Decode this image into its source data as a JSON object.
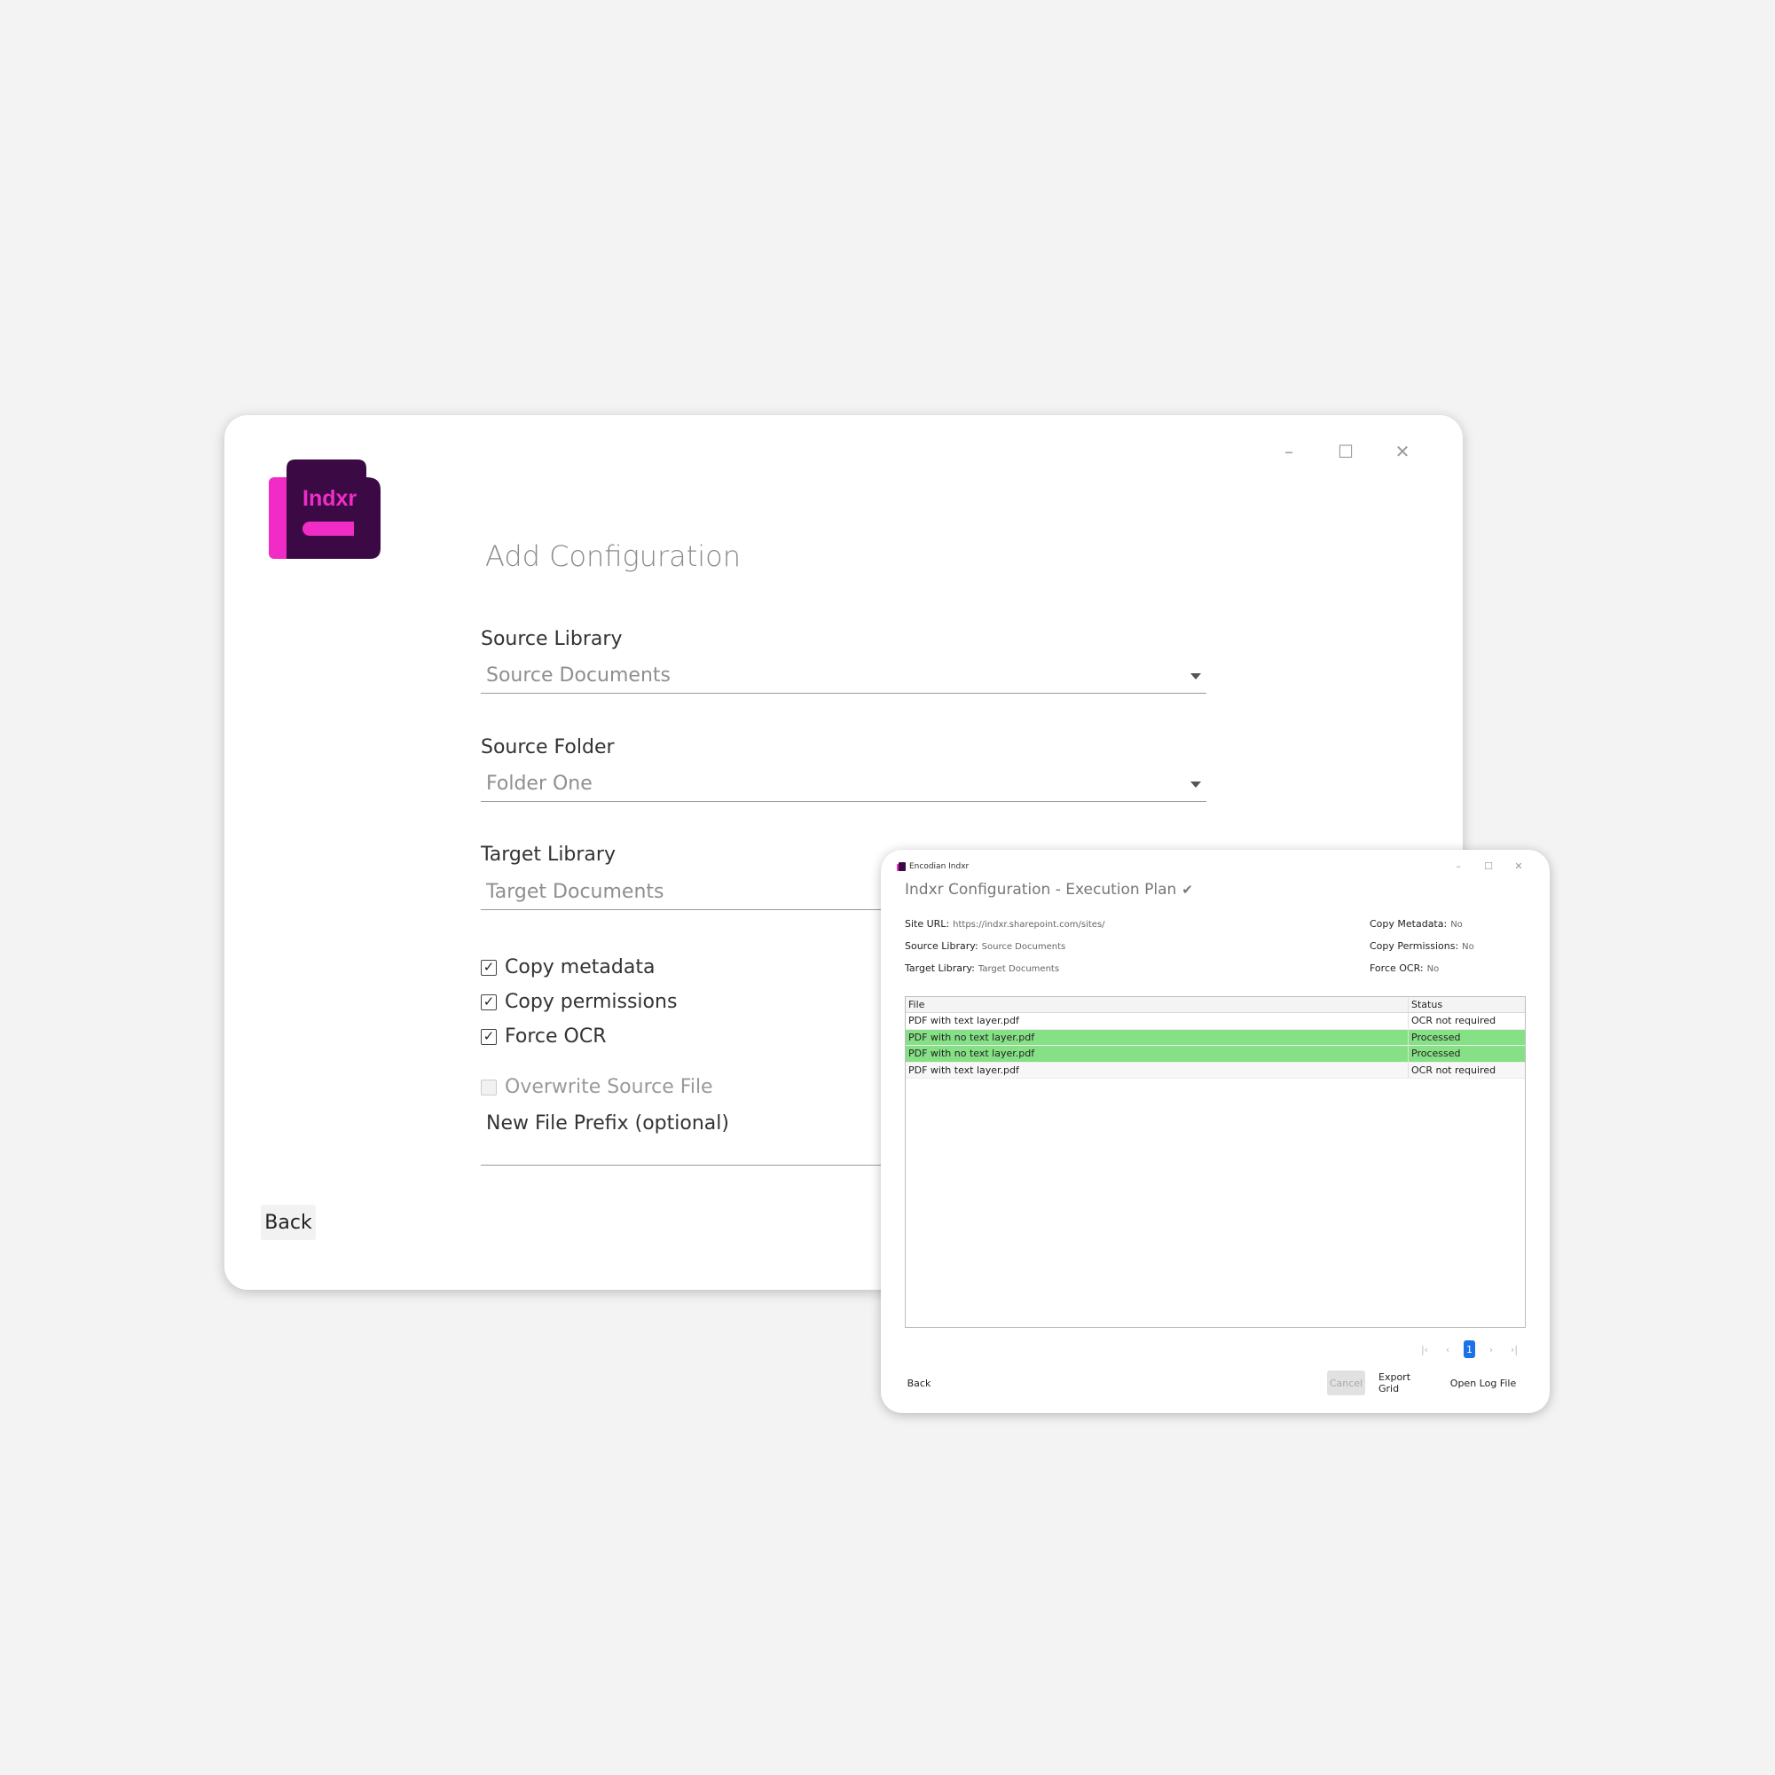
{
  "main_window": {
    "window_controls": {
      "minimize": "–",
      "maximize": "☐",
      "close": "✕"
    },
    "logo_text": "Indxr",
    "title": "Add Configuration",
    "source_library": {
      "label": "Source Library",
      "value": "Source Documents"
    },
    "source_folder": {
      "label": "Source Folder",
      "value": "Folder One"
    },
    "target_library": {
      "label": "Target Library",
      "value": "Target Documents"
    },
    "options": [
      {
        "label": "Copy metadata",
        "checked": true,
        "enabled": true
      },
      {
        "label": "Copy permissions",
        "checked": true,
        "enabled": true
      },
      {
        "label": "Force OCR",
        "checked": true,
        "enabled": true
      },
      {
        "label": "Overwrite Source File",
        "checked": false,
        "enabled": false
      }
    ],
    "prefix_label": "New File Prefix (optional)",
    "back_label": "Back",
    "brand_colors": {
      "dark": "#3b0a45",
      "accent": "#f02bc6"
    }
  },
  "exec_window": {
    "app_name": "Encodian Indxr",
    "window_controls": {
      "minimize": "–",
      "maximize": "☐",
      "close": "✕"
    },
    "title": "Indxr Configuration - Execution Plan",
    "info_left": [
      {
        "key": "Site URL:",
        "value": "https://indxr.sharepoint.com/sites/"
      },
      {
        "key": "Source Library:",
        "value": "Source Documents"
      },
      {
        "key": "Target Library:",
        "value": "Target Documents"
      }
    ],
    "info_right": [
      {
        "key": "Copy Metadata:",
        "value": "No"
      },
      {
        "key": "Copy Permissions:",
        "value": "No"
      },
      {
        "key": "Force OCR:",
        "value": "No"
      }
    ],
    "grid": {
      "columns": [
        "File",
        "Status"
      ],
      "rows": [
        {
          "file": "PDF with text layer.pdf",
          "status": "OCR not required",
          "highlight": false
        },
        {
          "file": "PDF with no text layer.pdf",
          "status": "Processed",
          "highlight": true
        },
        {
          "file": "PDF with no text layer.pdf",
          "status": "Processed",
          "highlight": true
        },
        {
          "file": "PDF with text layer.pdf",
          "status": "OCR not required",
          "highlight": false
        }
      ],
      "highlight_color": "#86e085"
    },
    "pager": {
      "current_page": "1"
    },
    "buttons": {
      "back": "Back",
      "cancel": "Cancel",
      "export": "Export Grid",
      "open_log": "Open Log File"
    }
  }
}
